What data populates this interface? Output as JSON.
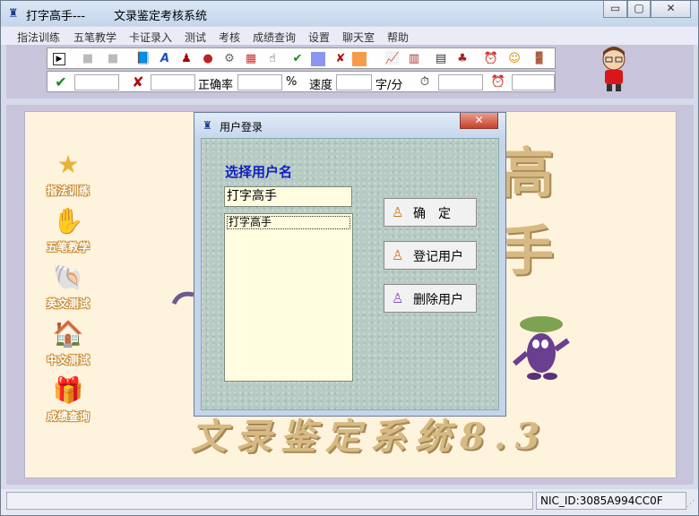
{
  "window": {
    "title": "打字高手---",
    "subtitle": "文录鉴定考核系统",
    "controls": {
      "minimize": "▭",
      "maximize": "▢",
      "close": "✕"
    }
  },
  "menu": [
    "指法训练",
    "五笔教学",
    "卡证录入",
    "测试",
    "考核",
    "成绩查询",
    "设置",
    "聊天室",
    "帮助"
  ],
  "toolbar": {
    "row1_icons": [
      "play-icon",
      "pause-icon",
      "stop-icon",
      "book-icon",
      "text-a-icon",
      "font-icon",
      "color-balls-icon",
      "gears-icon",
      "palette-icon",
      "pointer-icon",
      "check-icon",
      "blue-square-icon",
      "cross-icon",
      "orange-square-icon",
      "chart-icon",
      "bar-chart-icon",
      "document-icon",
      "network-icon",
      "alarm-clock-icon",
      "person-icon",
      "exit-door-icon"
    ],
    "correct_icon": "✔",
    "wrong_icon": "✘",
    "accuracy_label": "正确率",
    "percent_label": "%",
    "speed_label": "速度",
    "speed_unit": "字/分",
    "timer_icon": "⏱",
    "alarm_icon": "⏰"
  },
  "sidebar": [
    {
      "label": "指法训练",
      "icon": "star-icon",
      "glyph": "★"
    },
    {
      "label": "五笔教学",
      "icon": "hand-icon",
      "glyph": "✋"
    },
    {
      "label": "英文测试",
      "icon": "shell-icon",
      "glyph": "🐚"
    },
    {
      "label": "中文测试",
      "icon": "house-icon",
      "glyph": "🏠"
    },
    {
      "label": "成绩查询",
      "icon": "gift-icon",
      "glyph": "🎁"
    }
  ],
  "background": {
    "title_partial": "高 手",
    "footer_title": "文录鉴定系统8.3"
  },
  "dialog": {
    "title": "用户登录",
    "close": "✕",
    "heading": "选择用户名",
    "username_value": "打字高手",
    "user_list": [
      "打字高手"
    ],
    "buttons": {
      "confirm": "确　定",
      "register": "登记用户",
      "delete": "删除用户"
    }
  },
  "status": {
    "nic": "NIC_ID:3085A994CC0F"
  }
}
